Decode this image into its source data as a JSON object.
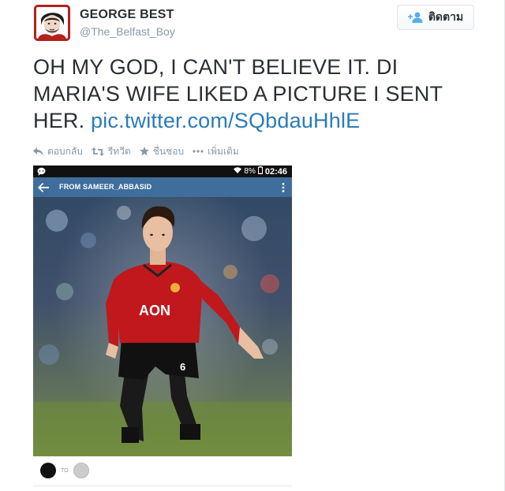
{
  "user": {
    "display_name": "GEORGE BEST",
    "handle": "@The_Belfast_Boy"
  },
  "follow_button": {
    "label": "ติดตาม",
    "icon": "follow-person-plus-icon"
  },
  "tweet": {
    "text": "OH MY GOD, I CAN'T BELIEVE IT. DI MARIA'S WIFE LIKED A PICTURE I SENT HER. ",
    "link": "pic.twitter.com/SQbdauHhlE"
  },
  "actions": [
    {
      "label": "ตอบกลับ",
      "icon": "reply-icon"
    },
    {
      "label": "รีทวีต",
      "icon": "retweet-icon"
    },
    {
      "label": "ชื่นชอบ",
      "icon": "star-icon"
    },
    {
      "label": "เพิ่มเติม",
      "icon": "more-dots-icon"
    }
  ],
  "media": {
    "status_bar": {
      "battery": "8%",
      "time": "02:46"
    },
    "dm_header": {
      "from_label": "FROM SAMEER_ABBASID"
    },
    "footer": {
      "to_label": "TO"
    },
    "shirt_sponsor": "AON",
    "shirt_number": "6"
  },
  "colors": {
    "link": "#2b7bb9",
    "muted": "#8899a6",
    "dm_header": "#3f6e9c",
    "shirt_red": "#c0181c"
  }
}
